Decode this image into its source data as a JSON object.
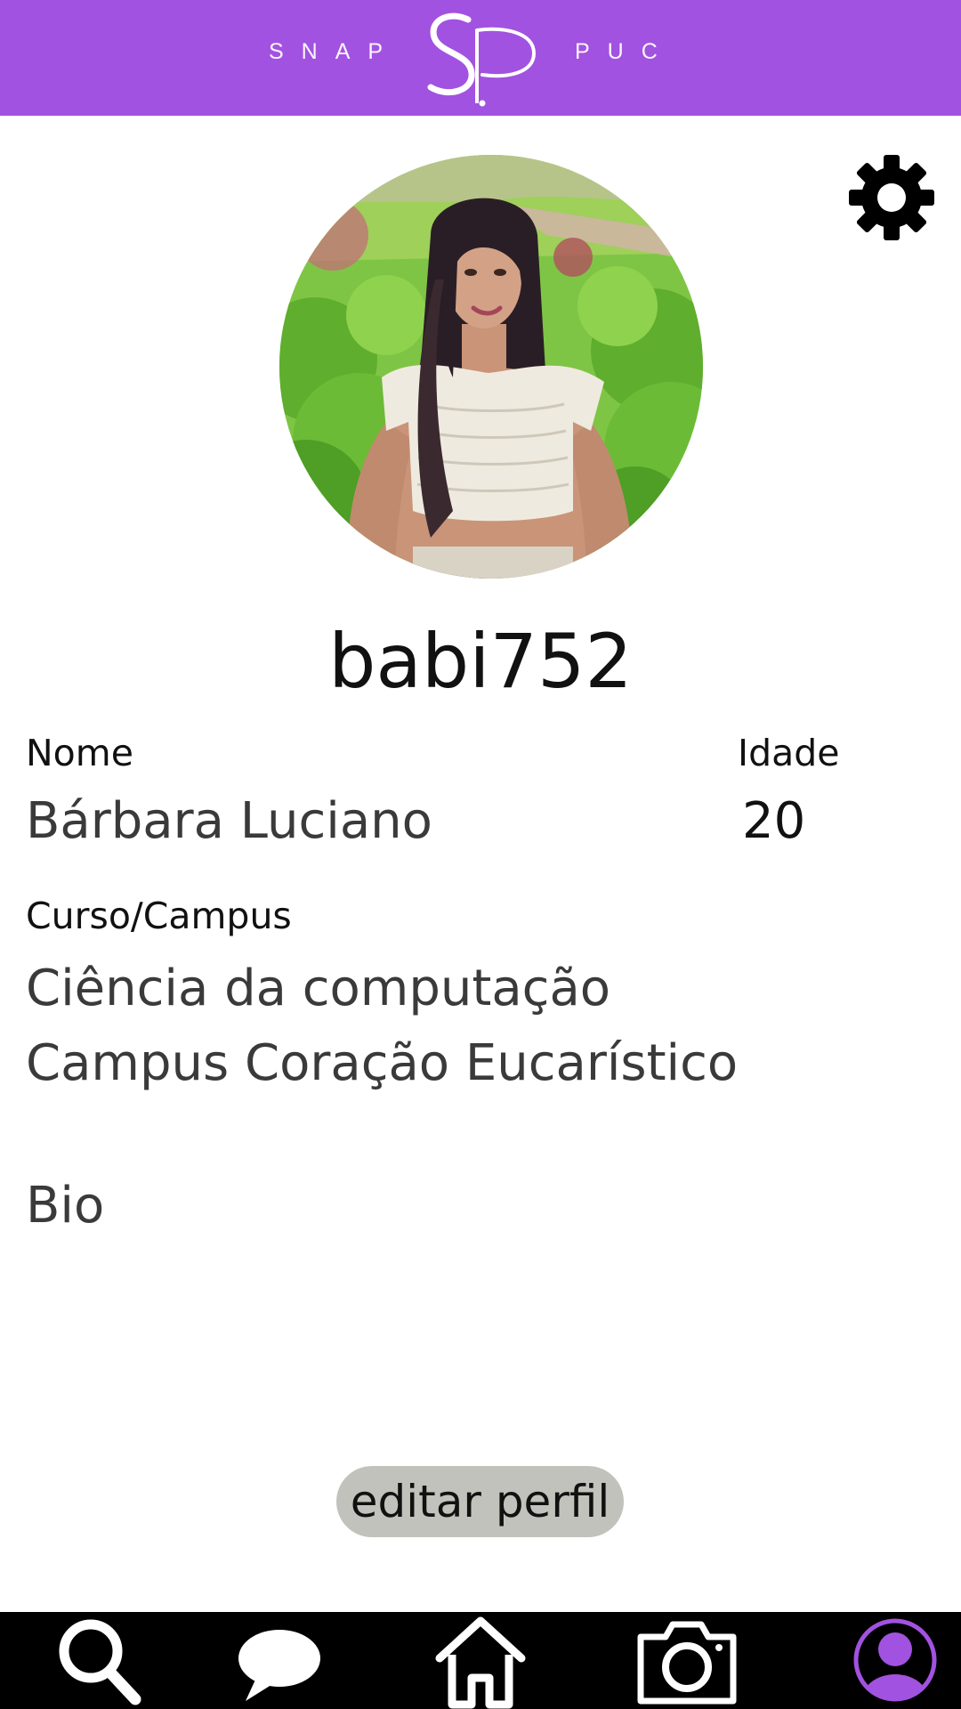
{
  "header": {
    "brand_left": "SNAP",
    "brand_right": "PUC",
    "logo_icon": "sp-logo-icon",
    "background_color": "#a252e0"
  },
  "settings": {
    "icon": "gear-icon"
  },
  "profile": {
    "username": "babi752",
    "name_label": "Nome",
    "name_value": "Bárbara Luciano",
    "age_label": "Idade",
    "age_value": "20",
    "course_label": "Curso/Campus",
    "course_value": "Ciência da computação",
    "campus_value": "Campus Coração Eucarístico",
    "bio_label": "Bio"
  },
  "actions": {
    "edit_profile_label": "editar perfil",
    "edit_button_color": "#c2c2bd"
  },
  "nav": {
    "items": [
      {
        "id": "search",
        "icon": "search-icon"
      },
      {
        "id": "chat",
        "icon": "chat-bubble-icon"
      },
      {
        "id": "home",
        "icon": "home-icon"
      },
      {
        "id": "camera",
        "icon": "camera-icon"
      },
      {
        "id": "profile",
        "icon": "user-profile-icon",
        "active": true
      }
    ],
    "accent_color": "#a252e0"
  }
}
